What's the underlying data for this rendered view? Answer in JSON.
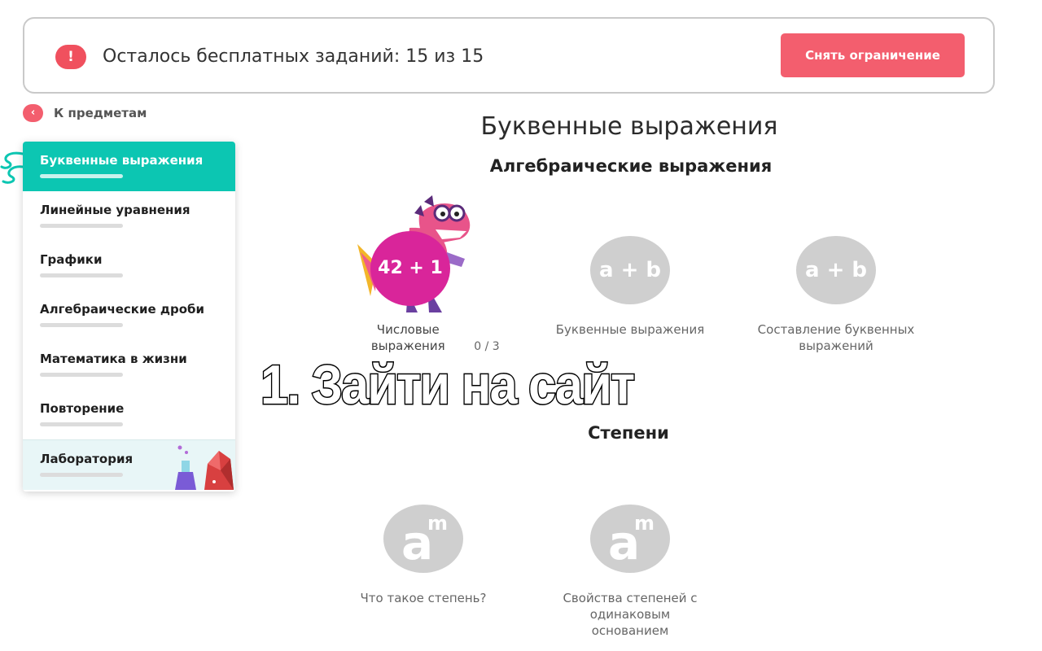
{
  "banner": {
    "alert_symbol": "!",
    "text": "Осталось бесплатных заданий: 15 из 15",
    "button_label": "Снять ограничение",
    "accent_color": "#f35e6e"
  },
  "back_link": {
    "icon_symbol": "‹",
    "label": "К предметам"
  },
  "sidebar": {
    "items": [
      {
        "label": "Буквенные выражения",
        "active": true
      },
      {
        "label": "Линейные уравнения"
      },
      {
        "label": "Графики"
      },
      {
        "label": "Алгебраические дроби"
      },
      {
        "label": "Математика в жизни"
      },
      {
        "label": "Повторение"
      },
      {
        "label": "Лаборатория"
      }
    ],
    "active_color": "#0cc6b2"
  },
  "main": {
    "title": "Буквенные выражения",
    "sections": [
      {
        "title": "Алгебраические выражения",
        "topics": [
          {
            "label": "Числовые выражения",
            "progress": "0 / 3",
            "badge": "42 + 1",
            "icon": "dino-mascot"
          },
          {
            "label": "Буквенные выражения",
            "glyph": "a + b",
            "icon": "a-plus-b-icon"
          },
          {
            "label": "Составление буквенных выражений",
            "glyph": "a + b",
            "icon": "a-plus-b-icon"
          }
        ]
      },
      {
        "title": "Степени",
        "topics": [
          {
            "label": "Что такое степень?",
            "glyph_base": "a",
            "glyph_exp": "m",
            "icon": "a-power-m-icon"
          },
          {
            "label": "Свойства степеней с одинаковым основанием",
            "glyph_base": "a",
            "glyph_exp": "m",
            "icon": "a-power-m-icon"
          }
        ]
      }
    ]
  },
  "overlay_caption": "1. Зайти на сайт"
}
